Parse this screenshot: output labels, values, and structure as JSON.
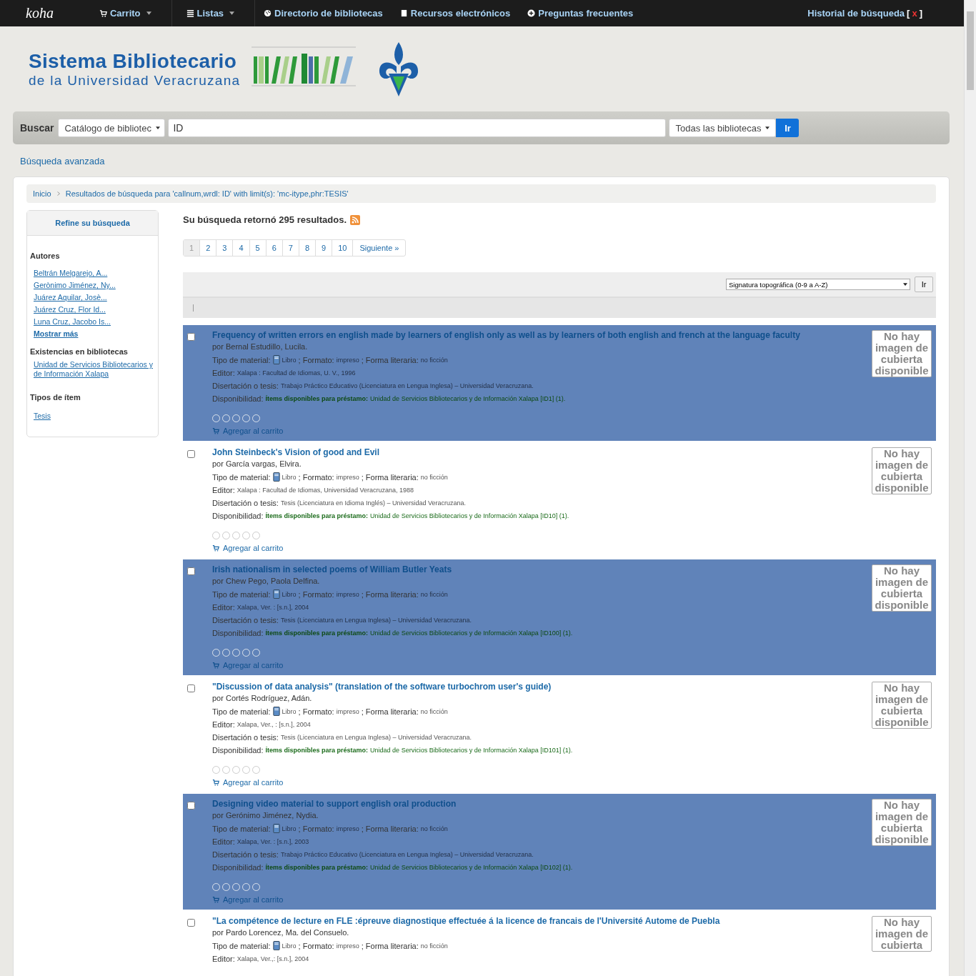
{
  "navbar": {
    "logo": "koha",
    "items": [
      {
        "label": "Carrito",
        "kind": "cart",
        "dropdown": true
      },
      {
        "label": "Listas",
        "kind": "list",
        "dropdown": true
      },
      {
        "label": "Directorio de bibliotecas",
        "kind": "globe",
        "dropdown": false
      },
      {
        "label": "Recursos electrónicos",
        "kind": "doc",
        "dropdown": false
      },
      {
        "label": "Preguntas frecuentes",
        "kind": "plus",
        "dropdown": false
      }
    ],
    "history": {
      "label": "Historial de búsqueda",
      "open": "[",
      "clear": "x",
      "close": "]"
    }
  },
  "banner": {
    "title": "Sistema Bibliotecario",
    "subtitle": "de la Universidad Veracruzana"
  },
  "search": {
    "label": "Buscar",
    "index": "Catálogo de bibliotec",
    "query": "ID",
    "library": "Todas las bibliotecas",
    "button": "Ir",
    "advanced": "Búsqueda avanzada"
  },
  "breadcrumbs": [
    "Inicio",
    "Resultados de búsqueda para 'callnum,wrdl: ID' with limit(s): 'mc-itype,phr:TESIS'"
  ],
  "facets": {
    "title": "Refine su búsqueda",
    "groups": [
      {
        "heading": "Autores",
        "links": [
          "Beltrán Melgarejo, A...",
          "Gerònimo Jiménez, Ny...",
          "Juárez Aquilar, Josè...",
          "Juárez Cruz, Flor Id...",
          "Luna Cruz, Jacobo Is..."
        ],
        "more": "Mostrar más"
      },
      {
        "heading": "Existencias en bibliotecas",
        "links": [
          "Unidad de Servicios Bibliotecarios y de Información Xalapa"
        ]
      },
      {
        "heading": "Tipos de ítem",
        "links": [
          "Tesis"
        ]
      }
    ]
  },
  "summary": "Su búsqueda retornó 295 resultados.",
  "pagination": [
    {
      "label": "1",
      "selected": true
    },
    {
      "label": "2",
      "selected": false
    },
    {
      "label": "3",
      "selected": false
    },
    {
      "label": "4",
      "selected": false
    },
    {
      "label": "5",
      "selected": false
    },
    {
      "label": "6",
      "selected": false
    },
    {
      "label": "7",
      "selected": false
    },
    {
      "label": "8",
      "selected": false
    },
    {
      "label": "9",
      "selected": false
    },
    {
      "label": "10",
      "selected": false
    },
    {
      "label": "Siguiente »",
      "selected": false
    }
  ],
  "sort": {
    "value": "Signatura topográfica (0-9 a A-Z)",
    "button": "Ir"
  },
  "results": [
    {
      "highlighted": true,
      "checked": false,
      "title": "Frequency of written errors en english made by learners of english only as well as by learners of both english and french at the language faculty",
      "author": "por Bernal Estudillo, Lucila.",
      "type_label": "Tipo de material:",
      "type": "Libro",
      "format_label": "; Formato:",
      "format": "impreso",
      "literary_label": "; Forma literaria:",
      "literary": "no ficción",
      "publisher_label": "Editor:",
      "publisher": "Xalapa : Facultad de Idiomas, U. V., 1996",
      "thesis_label": "Disertación o tesis:",
      "thesis": "Trabajo Práctico Educativo (Licenciatura en Lengua Inglesa) – Universidad Veracruzana.",
      "availability_label": "Disponibilidad:",
      "available": "Ítems disponibles para préstamo:",
      "holding": "Unidad de Servicios Bibliotecarios y de Información Xalapa [ID1] (1).",
      "stars": 0,
      "cart": "Agregar al carrito",
      "cover": "No hay imagen de cubierta disponible"
    },
    {
      "highlighted": false,
      "checked": false,
      "title": "John Steinbeck's Vision of good and Evil",
      "author": "por García vargas, Elvira.",
      "type_label": "Tipo de material:",
      "type": "Libro",
      "format_label": "; Formato:",
      "format": "impreso",
      "literary_label": "; Forma literaria:",
      "literary": "no ficción",
      "publisher_label": "Editor:",
      "publisher": "Xalapa : Facultad de Idiomas, Universidad Veracruzana, 1988",
      "thesis_label": "Disertación o tesis:",
      "thesis": "Tesis (Licenciatura en Idioma Inglés) – Universidad Veracruzana.",
      "availability_label": "Disponibilidad:",
      "available": "Ítems disponibles para préstamo:",
      "holding": "Unidad de Servicios Bibliotecarios y de Información Xalapa [ID10] (1).",
      "stars": 0,
      "cart": "Agregar al carrito",
      "cover": "No hay imagen de cubierta disponible"
    },
    {
      "highlighted": true,
      "checked": false,
      "title": "Irish nationalism in selected poems of William Butler Yeats",
      "author": "por Chew Pego, Paola Delfina.",
      "type_label": "Tipo de material:",
      "type": "Libro",
      "format_label": "; Formato:",
      "format": "impreso",
      "literary_label": "; Forma literaria:",
      "literary": "no ficción",
      "publisher_label": "Editor:",
      "publisher": "Xalapa, Ver. : [s.n.], 2004",
      "thesis_label": "Disertación o tesis:",
      "thesis": "Tesis (Licenciatura en Lengua Inglesa) – Universidad Veracruzana.",
      "availability_label": "Disponibilidad:",
      "available": "Ítems disponibles para préstamo:",
      "holding": "Unidad de Servicios Bibliotecarios y de Información Xalapa [ID100] (1).",
      "stars": 0,
      "cart": "Agregar al carrito",
      "cover": "No hay imagen de cubierta disponible"
    },
    {
      "highlighted": false,
      "checked": false,
      "title": "\"Discussion of data analysis\" (translation of the software turbochrom user's guide)",
      "author": "por Cortés Rodríguez, Adán.",
      "type_label": "Tipo de material:",
      "type": "Libro",
      "format_label": "; Formato:",
      "format": "impreso",
      "literary_label": "; Forma literaria:",
      "literary": "no ficción",
      "publisher_label": "Editor:",
      "publisher": "Xalapa, Ver., : [s.n.], 2004",
      "thesis_label": "Disertación o tesis:",
      "thesis": "Tesis (Licenciatura en Lengua Inglesa) – Universidad Veracruzana.",
      "availability_label": "Disponibilidad:",
      "available": "Ítems disponibles para préstamo:",
      "holding": "Unidad de Servicios Bibliotecarios y de Información Xalapa [ID101] (1).",
      "stars": 0,
      "cart": "Agregar al carrito",
      "cover": "No hay imagen de cubierta disponible"
    },
    {
      "highlighted": true,
      "checked": false,
      "title": "Designing video material to support english oral production",
      "author": "por Gerónimo Jiménez, Nydia.",
      "type_label": "Tipo de material:",
      "type": "Libro",
      "format_label": "; Formato:",
      "format": "impreso",
      "literary_label": "; Forma literaria:",
      "literary": "no ficción",
      "publisher_label": "Editor:",
      "publisher": "Xalapa, Ver. : [s.n.], 2003",
      "thesis_label": "Disertación o tesis:",
      "thesis": "Trabajo Práctico Educativo (Licenciatura en Lengua Inglesa) – Universidad Veracruzana.",
      "availability_label": "Disponibilidad:",
      "available": "Ítems disponibles para préstamo:",
      "holding": "Unidad de Servicios Bibliotecarios y de Información Xalapa [ID102] (1).",
      "stars": 0,
      "cart": "Agregar al carrito",
      "cover": "No hay imagen de cubierta disponible"
    },
    {
      "highlighted": false,
      "checked": false,
      "title": "\"La compétence de lecture en FLE :épreuve diagnostique effectuée á la licence de francais de l'Université Autome de Puebla",
      "author": "por Pardo Lorencez, Ma. del Consuelo.",
      "type_label": "Tipo de material:",
      "type": "Libro",
      "format_label": "; Formato:",
      "format": "impreso",
      "literary_label": "; Forma literaria:",
      "literary": "no ficción",
      "publisher_label": "Editor:",
      "publisher": "Xalapa, Ver.,: [s.n.], 2004",
      "cover": "No hay imagen de cubierta"
    }
  ]
}
